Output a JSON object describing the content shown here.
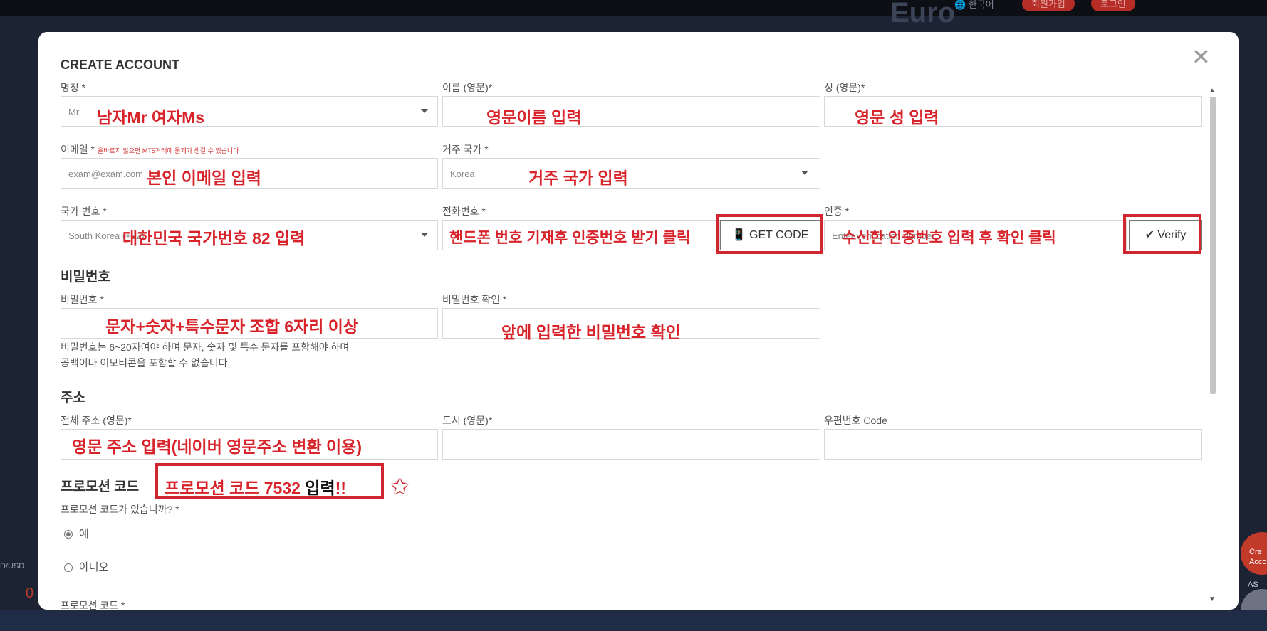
{
  "topbar": {
    "language": "🌐 한국어",
    "signup": "회원가입",
    "login": "로그인"
  },
  "background": {
    "euro_text": "Euro",
    "left_pair": "D/USD",
    "left_value": "0",
    "right_a": "Cre",
    "right_b": "Accou",
    "right_c": "AS"
  },
  "modal": {
    "title": "CREATE ACCOUNT",
    "close": "✕",
    "fields": {
      "salutation_label": "명칭 *",
      "salutation_value": "Mr",
      "first_name_label": "이름 (영문)*",
      "last_name_label": "성 (영문)*",
      "email_label": "이메일 *",
      "email_warning": "올바르지 않으면 MT5거래에 문제가 생길 수 있습니다",
      "email_placeholder": "exam@exam.com",
      "country_label": "거주 국가 *",
      "country_value": "Korea",
      "country_code_label": "국가 번호 *",
      "country_code_value": "South Korea (+82)",
      "phone_label": "전화번호 *",
      "get_code_button": "📱 GET CODE",
      "verification_label": "인증 *",
      "verification_placeholder": "Enter verification number",
      "verify_button": "✔ Verify"
    },
    "password_section": {
      "title": "비밀번호",
      "password_label": "비밀번호 *",
      "confirm_label": "비밀번호 확인 *",
      "hint_line1": "비밀번호는 6~20자여야 하며 문자, 숫자 및 특수 문자를 포함해야 하며",
      "hint_line2": "공백이나 이모티콘을 포함할 수 없습니다."
    },
    "address_section": {
      "title": "주소",
      "full_address_label": "전체 주소 (영문)*",
      "city_label": "도시 (영문)*",
      "postcode_label": "우편번호 Code"
    },
    "promotion_section": {
      "title": "프로모션 코드",
      "question": "프로모션 코드가 있습니까? *",
      "yes": "예",
      "no": "아니오",
      "code_label": "프로모션 코드 *"
    }
  },
  "annotations": {
    "salutation": "남자Mr  여자Ms",
    "first_name": "영문이름 입력",
    "last_name": "영문 성 입력",
    "email": "본인 이메일 입력",
    "country": "거주 국가 입력",
    "country_code": "대한민국 국가번호 82 입력",
    "phone": "핸드폰 번호 기재후 인증번호 받기 클릭",
    "verification": "수신한 인증번호 입력 후 확인 클릭",
    "password": "문자+숫자+특수문자 조합 6자리 이상",
    "confirm": "앞에 입력한 비밀번호 확인",
    "address": "영문 주소 입력(네이버 영문주소 변환 이용)",
    "promo_red": "프로모션 코드 7532 ",
    "promo_black": "입력",
    "promo_exclaim": "!!",
    "star": "✩"
  }
}
